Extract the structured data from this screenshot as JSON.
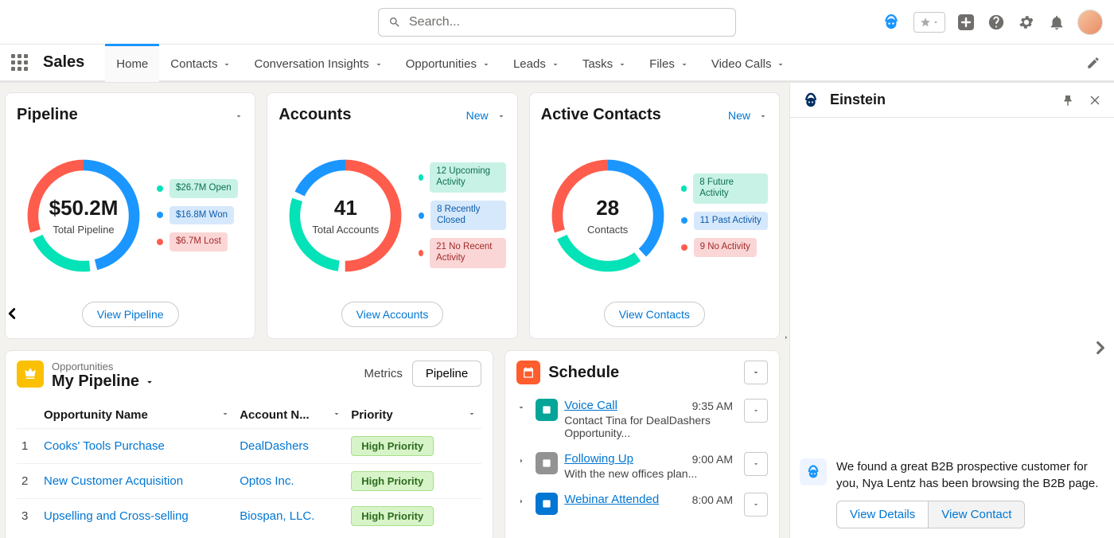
{
  "search": {
    "placeholder": "Search..."
  },
  "app_name": "Sales",
  "nav_tabs": [
    {
      "label": "Home",
      "dropdown": false,
      "active": true
    },
    {
      "label": "Contacts",
      "dropdown": true
    },
    {
      "label": "Conversation Insights",
      "dropdown": true
    },
    {
      "label": "Opportunities",
      "dropdown": true
    },
    {
      "label": "Leads",
      "dropdown": true
    },
    {
      "label": "Tasks",
      "dropdown": true
    },
    {
      "label": "Files",
      "dropdown": true
    },
    {
      "label": "Video Calls",
      "dropdown": true
    }
  ],
  "cards": {
    "pipeline": {
      "title": "Pipeline",
      "center_value": "$50.2M",
      "center_label": "Total Pipeline",
      "legend": [
        {
          "color": "#04e2b7",
          "pill_class": "teal",
          "text": "$26.7M Open"
        },
        {
          "color": "#1b96ff",
          "pill_class": "blue",
          "text": "$16.8M Won"
        },
        {
          "color": "#fe5c4c",
          "pill_class": "red",
          "text": "$6.7M Lost"
        }
      ],
      "button": "View Pipeline"
    },
    "accounts": {
      "title": "Accounts",
      "new_label": "New",
      "center_value": "41",
      "center_label": "Total Accounts",
      "legend": [
        {
          "color": "#04e2b7",
          "pill_class": "teal",
          "text": "12 Upcoming Activity"
        },
        {
          "color": "#1b96ff",
          "pill_class": "blue",
          "text": "8 Recently Closed"
        },
        {
          "color": "#fe5c4c",
          "pill_class": "red",
          "text": "21 No Recent Activity"
        }
      ],
      "button": "View Accounts"
    },
    "contacts": {
      "title": "Active Contacts",
      "new_label": "New",
      "center_value": "28",
      "center_label": "Contacts",
      "legend": [
        {
          "color": "#04e2b7",
          "pill_class": "teal",
          "text": "8 Future Activity"
        },
        {
          "color": "#1b96ff",
          "pill_class": "blue",
          "text": "11 Past Activity"
        },
        {
          "color": "#fe5c4c",
          "pill_class": "red",
          "text": "9 No Activity"
        }
      ],
      "button": "View Contacts"
    }
  },
  "opportunities": {
    "eyebrow": "Opportunities",
    "title": "My Pipeline",
    "seg_metric": "Metrics",
    "seg_pipeline": "Pipeline",
    "columns": {
      "name": "Opportunity Name",
      "account": "Account N...",
      "priority": "Priority"
    },
    "rows": [
      {
        "idx": "1",
        "name": "Cooks' Tools Purchase",
        "account": "DealDashers",
        "priority": "High Priority"
      },
      {
        "idx": "2",
        "name": "New Customer Acquisition",
        "account": "Optos Inc.",
        "priority": "High Priority"
      },
      {
        "idx": "3",
        "name": "Upselling and Cross-selling",
        "account": "Biospan, LLC.",
        "priority": "High Priority"
      }
    ]
  },
  "schedule": {
    "title": "Schedule",
    "items": [
      {
        "icon_bg": "#06a59a",
        "title": "Voice Call",
        "time": "9:35 AM",
        "sub": "Contact Tina for DealDashers Opportunity...",
        "expanded": true
      },
      {
        "icon_bg": "#939393",
        "title": "Following Up",
        "time": "9:00 AM",
        "sub": "With the new offices plan...",
        "expanded": false
      },
      {
        "icon_bg": "#0176d3",
        "title": "Webinar Attended",
        "time": "8:00 AM",
        "sub": "",
        "expanded": false
      }
    ]
  },
  "einstein": {
    "title": "Einstein",
    "message": "We found a great B2B prospective customer for you, Nya Lentz has been browsing the B2B page.",
    "btn_details": "View Details",
    "btn_contact": "View Contact"
  }
}
